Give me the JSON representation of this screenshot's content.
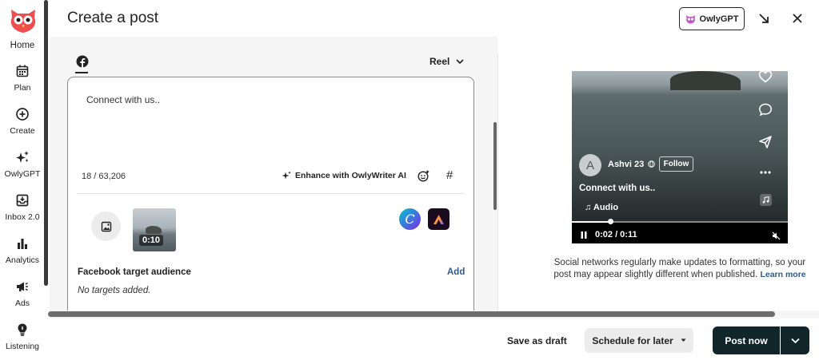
{
  "sidebar": {
    "home": "Home",
    "items": [
      {
        "label": "Plan",
        "icon": "calendar-icon"
      },
      {
        "label": "Create",
        "icon": "plus-circle-icon"
      },
      {
        "label": "OwlyGPT",
        "icon": "sparkle-icon"
      },
      {
        "label": "Inbox 2.0",
        "icon": "inbox-icon"
      },
      {
        "label": "Analytics",
        "icon": "bar-chart-icon"
      },
      {
        "label": "Ads",
        "icon": "megaphone-icon"
      },
      {
        "label": "Listening",
        "icon": "lightbulb-icon"
      }
    ]
  },
  "header": {
    "title": "Create a post",
    "owlygpt_label": "OwlyGPT"
  },
  "editor": {
    "post_type": "Reel",
    "text": "Connect with us..",
    "char_count": "18 / 63,206",
    "enhance_label": "Enhance with OwlyWriter AI",
    "hashtag": "#",
    "video_duration": "0:10",
    "canva_letter": "C",
    "audience_title": "Facebook target audience",
    "audience_add": "Add",
    "audience_empty": "No targets added."
  },
  "preview": {
    "avatar_letter": "A",
    "username": "Ashvi 23",
    "follow_label": "Follow",
    "caption": "Connect with us..",
    "audio_label": "♫ Audio",
    "time": "0:02 / 0:11",
    "progress": 0.18,
    "disclaimer": "Social networks regularly make updates to formatting, so your post may appear slightly different when published.",
    "learn_more": "Learn more"
  },
  "footer": {
    "save_draft": "Save as draft",
    "schedule": "Schedule for later",
    "post_now": "Post now"
  },
  "colors": {
    "primary_dark": "#11262a",
    "link": "#2f5b8a",
    "brand_red": "#f04e4e"
  }
}
